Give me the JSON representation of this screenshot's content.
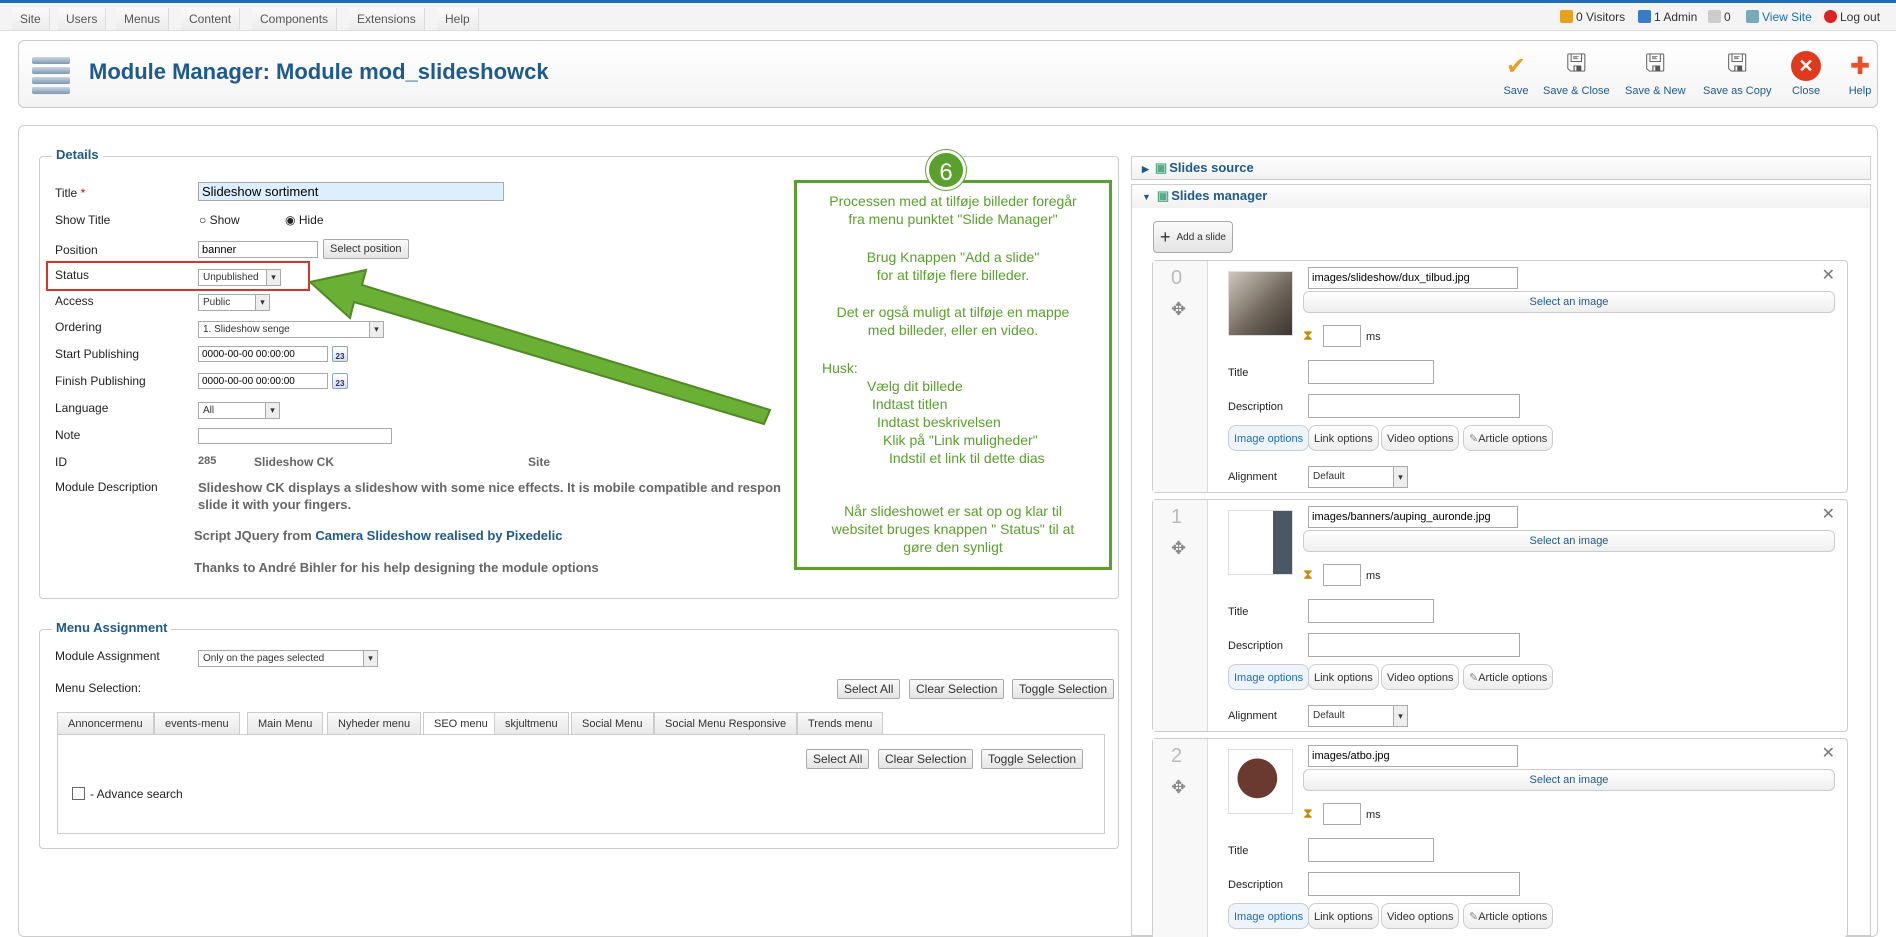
{
  "menu": [
    "Site",
    "Users",
    "Menus",
    "Content",
    "Components",
    "Extensions",
    "Help"
  ],
  "status": {
    "visitors": "0 Visitors",
    "admins": "1 Admin",
    "messages": "0",
    "view_site": "View Site",
    "logout": "Log out"
  },
  "header": {
    "title": "Module Manager: Module mod_slideshowck"
  },
  "toolbar": [
    {
      "label": "Save",
      "icon": "check-icon"
    },
    {
      "label": "Save & Close",
      "icon": "save-icon"
    },
    {
      "label": "Save & New",
      "icon": "save-new-icon"
    },
    {
      "label": "Save as Copy",
      "icon": "save-copy-icon"
    },
    {
      "label": "Close",
      "icon": "close-icon"
    },
    {
      "label": "Help",
      "icon": "help-icon"
    }
  ],
  "details": {
    "legend": "Details",
    "title_label": "Title",
    "title_value": "Slideshow sortiment",
    "show_title_label": "Show Title",
    "show": "Show",
    "hide": "Hide",
    "position_label": "Position",
    "position_value": "banner",
    "select_position": "Select position",
    "status_label": "Status",
    "status_value": "Unpublished",
    "access_label": "Access",
    "access_value": "Public",
    "ordering_label": "Ordering",
    "ordering_value": "1. Slideshow senge",
    "start_label": "Start Publishing",
    "start_value": "0000-00-00 00:00:00",
    "finish_label": "Finish Publishing",
    "finish_value": "0000-00-00 00:00:00",
    "language_label": "Language",
    "language_value": "All",
    "note_label": "Note",
    "id_label": "ID",
    "id_value": "285",
    "type": "Slideshow CK",
    "client": "Site",
    "desc_label": "Module Description",
    "desc1": "Slideshow CK displays a slideshow with some nice effects. It is mobile compatible and respon",
    "desc2": "slide it with your fingers.",
    "desc3_pre": "Script JQuery from ",
    "desc3_link": "Camera Slideshow realised by Pixedelic",
    "desc4": "Thanks to André Bihler for his help designing the module options",
    "calendar_num": "23"
  },
  "menu_assignment": {
    "legend": "Menu Assignment",
    "module_assignment_label": "Module Assignment",
    "module_assignment_value": "Only on the pages selected",
    "menu_selection_label": "Menu Selection:",
    "select_all": "Select All",
    "clear_selection": "Clear Selection",
    "toggle_selection": "Toggle Selection",
    "tabs": [
      "Annoncermenu",
      "events-menu",
      "Main Menu",
      "Nyheder menu",
      "SEO menu",
      "skjultmenu",
      "Social Menu",
      "Social Menu Responsive",
      "Trends menu"
    ],
    "item": "- Advance search"
  },
  "callout": {
    "badge": "6",
    "lines": [
      "Processen med at tilføje billeder foregår",
      "fra menu punktet \"Slide Manager\"",
      "",
      "Brug Knappen \"Add a slide\"",
      "for at tilføje flere billeder.",
      "",
      "Det er også muligt at tilføje en mappe",
      "med billeder, eller en video.",
      "",
      "Husk:",
      "Vælg dit billede",
      "Indtast titlen",
      "Indtast beskrivelsen",
      "Klik på \"Link muligheder\"",
      "Indstil et link til dette dias",
      "",
      "Når slideshowet er sat op og klar til",
      "websitet bruges knappen \" Status\" til at",
      "gøre den synligt"
    ]
  },
  "right": {
    "slides_source": "Slides source",
    "slides_manager": "Slides manager",
    "add_slide": "Add a slide",
    "select_image": "Select an image",
    "ms": "ms",
    "title": "Title",
    "description": "Description",
    "image_options": "Image options",
    "link_options": "Link options",
    "video_options": "Video options",
    "article_options": "Article options",
    "alignment": "Alignment",
    "alignment_value": "Default",
    "slides": [
      {
        "num": "0",
        "path": "images/slideshow/dux_tilbud.jpg"
      },
      {
        "num": "1",
        "path": "images/banners/auping_auronde.jpg"
      },
      {
        "num": "2",
        "path": "images/atbo.jpg"
      }
    ]
  }
}
